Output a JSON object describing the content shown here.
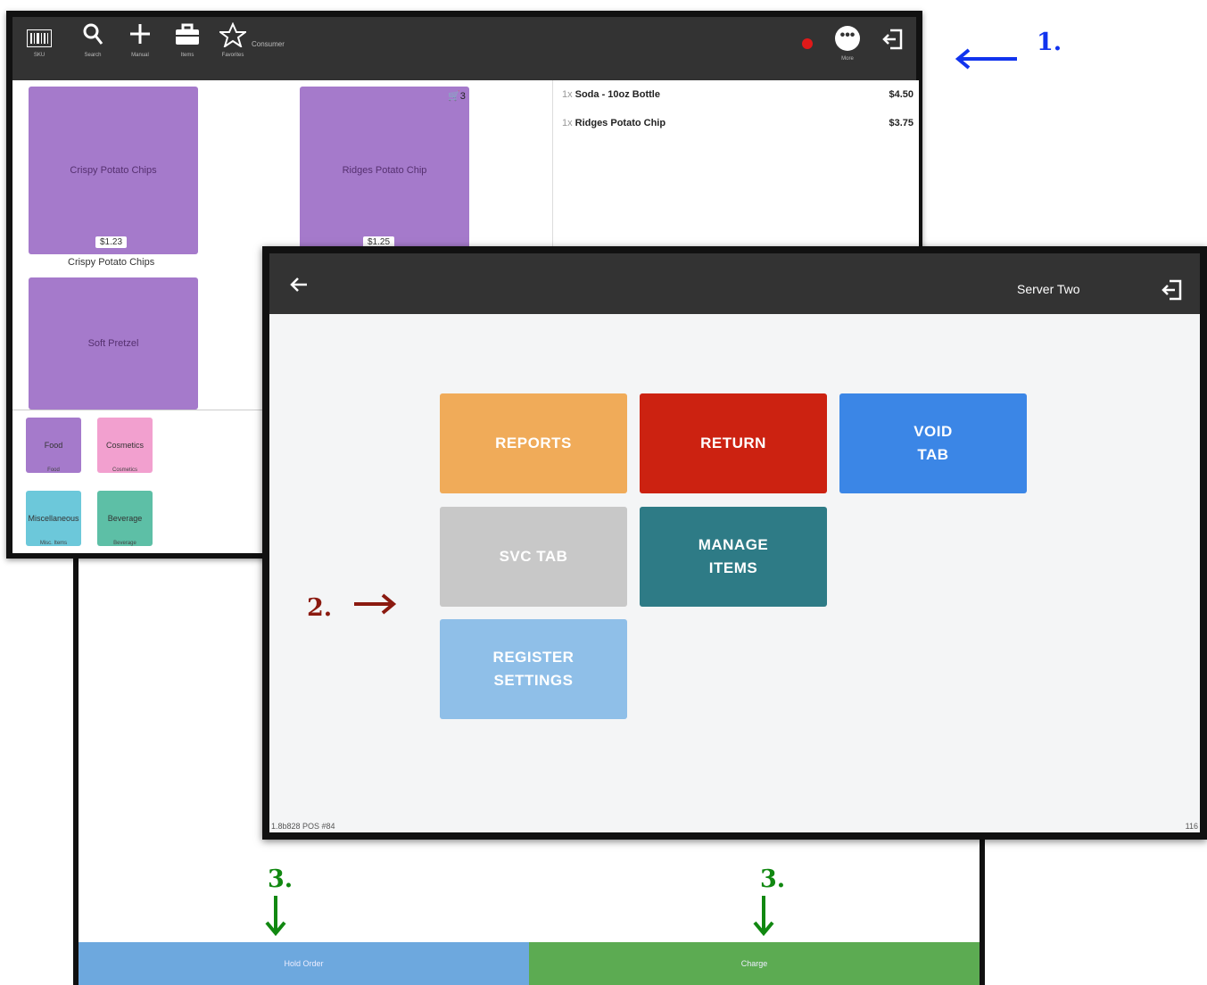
{
  "colors": {
    "topbar": "#333333",
    "item_tile": "#a57acb",
    "reports": "#f0ab59",
    "return": "#cc2211",
    "void_tab": "#3b86e6",
    "svc_tab": "#c8c8c8",
    "manage_items": "#2e7b86",
    "register_settings": "#8fbfe8",
    "bottom_left": "#6da8de",
    "bottom_right": "#5cab52",
    "annotation_1": "#1133ee",
    "annotation_2": "#8b1a10",
    "annotation_3": "#118811"
  },
  "pos_main": {
    "toolbar": [
      {
        "icon": "barcode-icon",
        "label": "SKU"
      },
      {
        "icon": "search-icon",
        "label": "Search"
      },
      {
        "icon": "plus-icon",
        "label": "Manual"
      },
      {
        "icon": "briefcase-icon",
        "label": "Items"
      },
      {
        "icon": "star-icon",
        "label": "Favorites"
      }
    ],
    "favorites_caption": "Consumer",
    "more_label": "More",
    "items": [
      {
        "name": "Crispy Potato Chips",
        "price": "$1.23",
        "caption": "Crispy Potato Chips"
      },
      {
        "name": "Ridges Potato Chip",
        "price": "$1.25",
        "cart_count": "3"
      },
      {
        "name": "Soft Pretzel"
      }
    ],
    "cart": [
      {
        "qty": "1x",
        "name": "Soda - 10oz Bottle",
        "price": "$4.50"
      },
      {
        "qty": "1x",
        "name": "Ridges Potato Chip",
        "price": "$3.75"
      }
    ],
    "categories": [
      {
        "label": "Food",
        "caption": "Food"
      },
      {
        "label": "Cosmetics",
        "caption": "Cosmetics"
      },
      {
        "label": "Miscellaneous",
        "caption": "Misc. Items"
      },
      {
        "label": "Beverage",
        "caption": "Beverage"
      }
    ]
  },
  "menu_screen": {
    "user": "Server Two",
    "buttons": {
      "reports": "REPORTS",
      "return": "RETURN",
      "void_tab": "VOID\nTAB",
      "svc_tab": "SVC TAB",
      "manage_items": "MANAGE\nITEMS",
      "register_settings": "REGISTER\nSETTINGS"
    },
    "version": "1.8b828 POS #84",
    "footer_right": "116"
  },
  "bottom_screen": {
    "left_label": "Hold Order",
    "right_label": "Charge"
  },
  "annotations": {
    "one": "1.",
    "two": "2.",
    "three": "3."
  }
}
